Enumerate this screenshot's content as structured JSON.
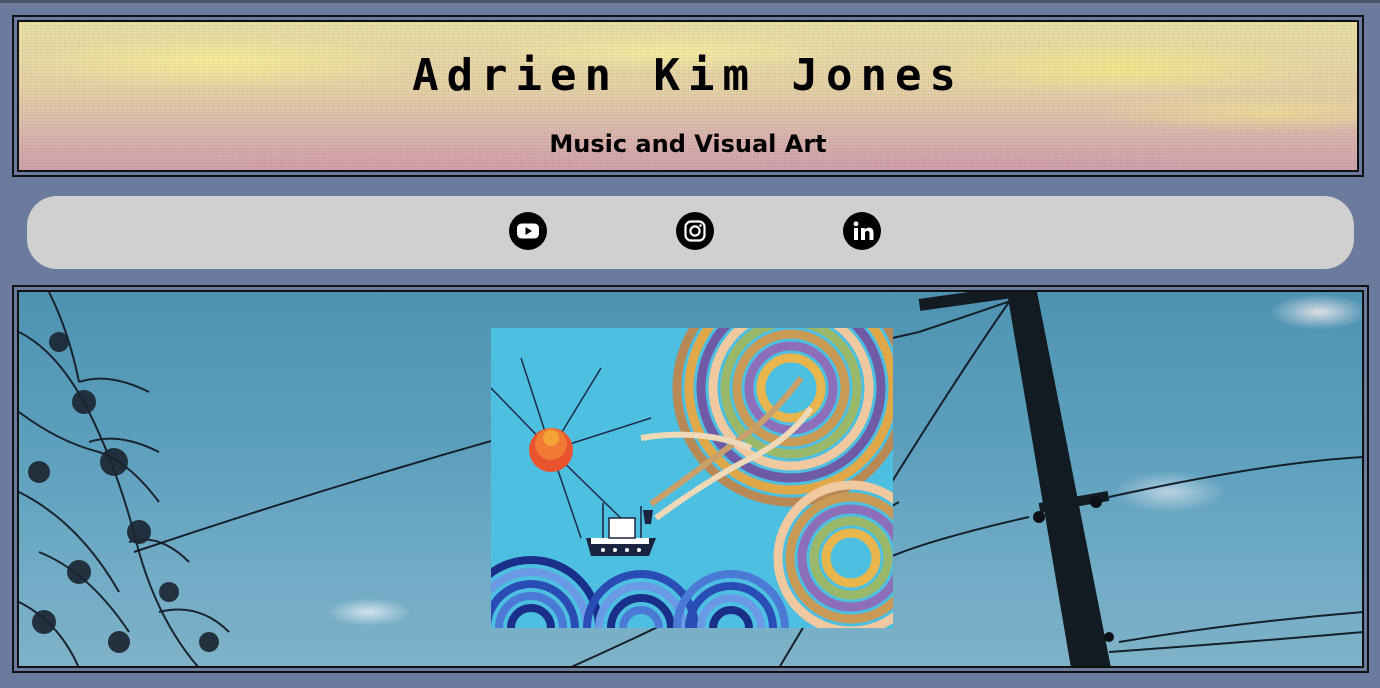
{
  "header": {
    "title": "Adrien Kim Jones",
    "subtitle": "Music and Visual Art"
  },
  "social": {
    "items": [
      {
        "icon": "youtube-icon"
      },
      {
        "icon": "instagram-icon"
      },
      {
        "icon": "linkedin-icon"
      }
    ]
  },
  "colors": {
    "page_background": "#6a7b9e",
    "social_bar": "#d0d0d0",
    "border": "#111111"
  },
  "gallery": {
    "background": "sky-with-power-lines",
    "artwork": "boat-on-waves-painting"
  }
}
